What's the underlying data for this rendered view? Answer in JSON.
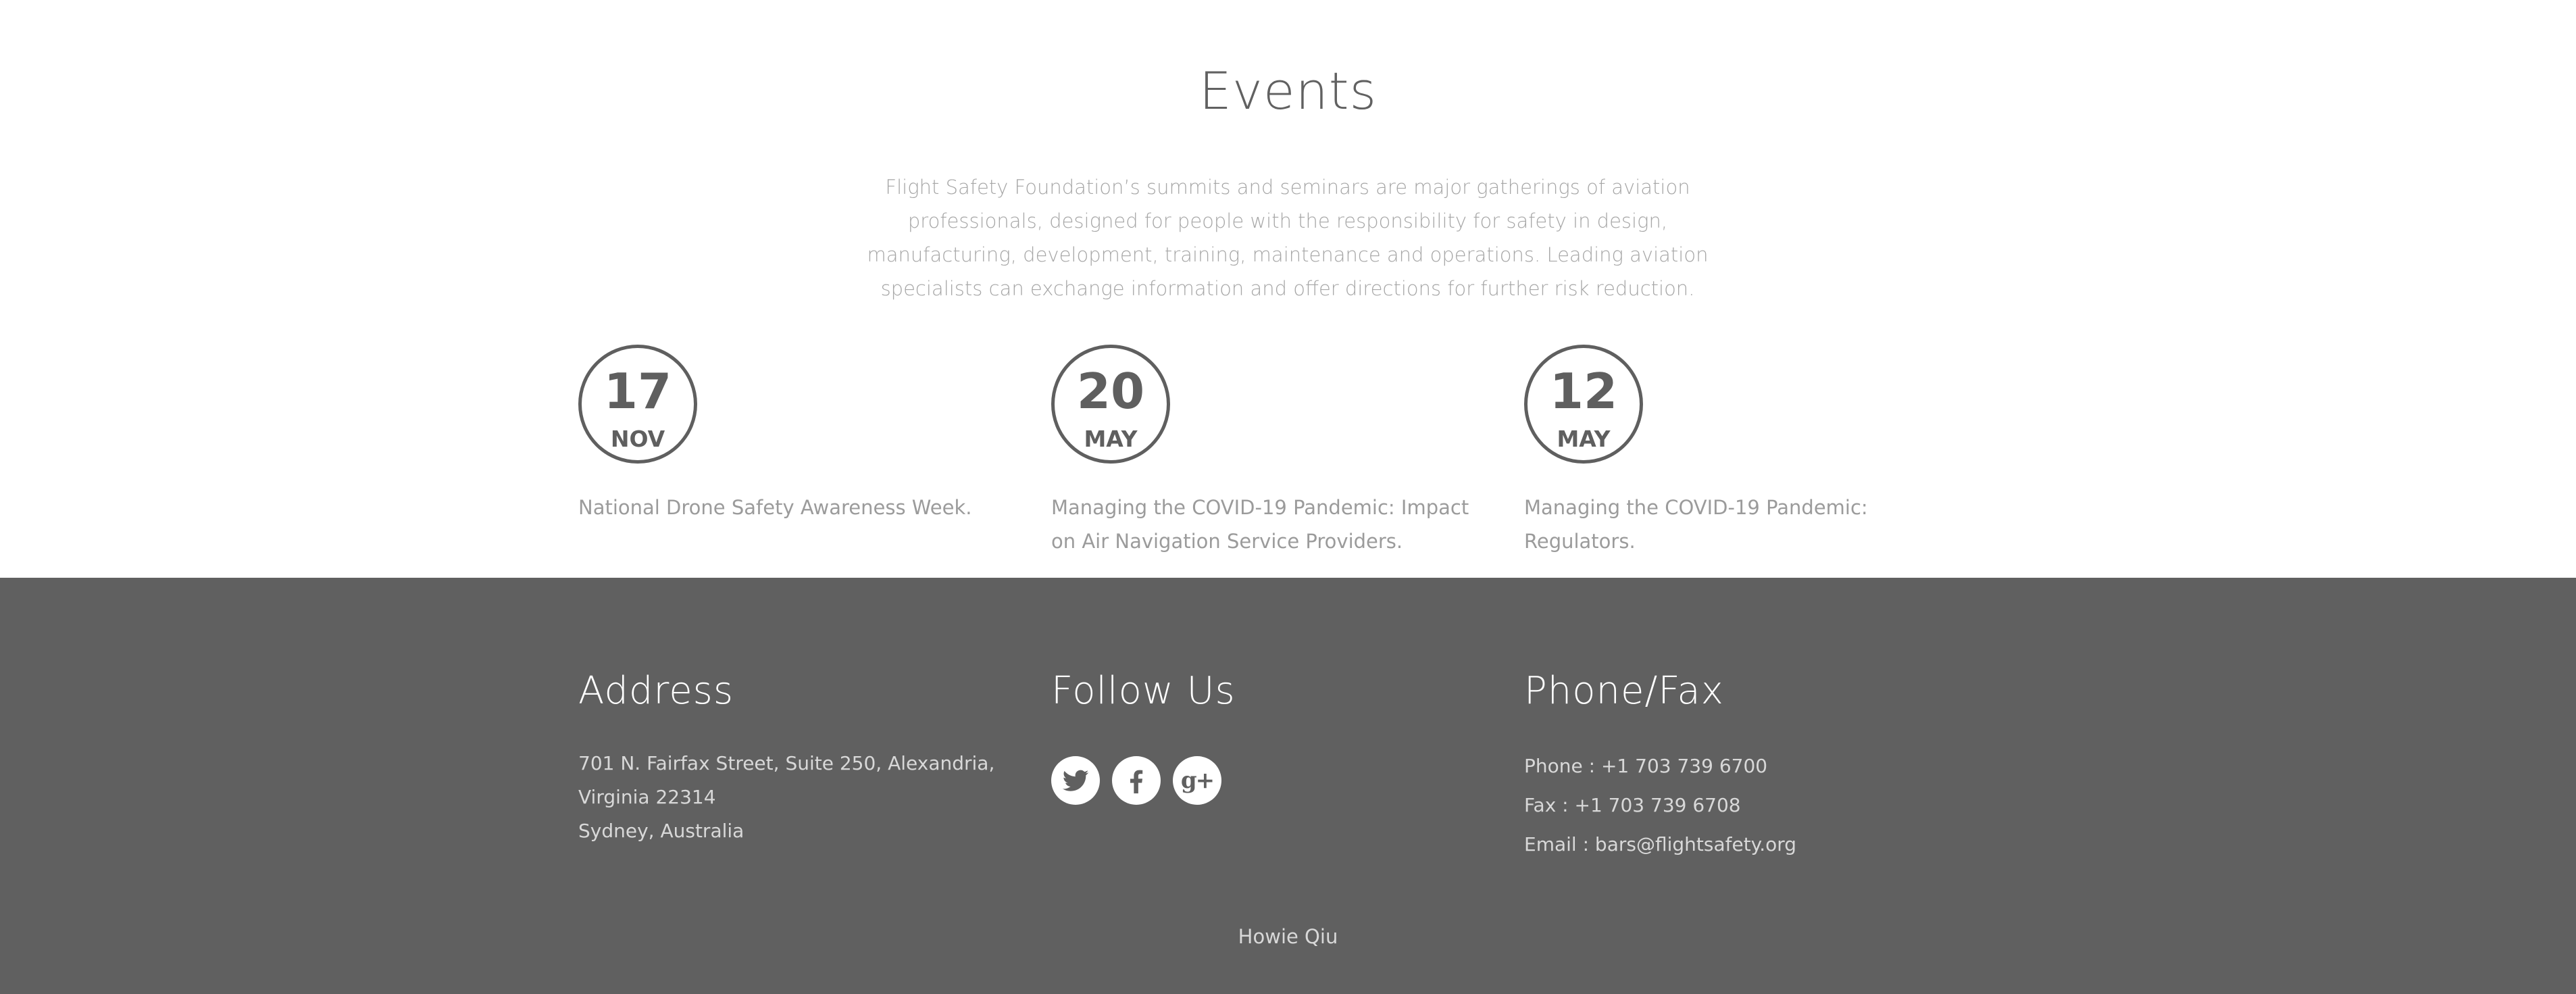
{
  "events": {
    "title": "Events",
    "intro": "Flight Safety Foundation’s summits and seminars are major gatherings of aviation professionals, designed for people with the responsibility for safety in design, manufacturing, development, training, maintenance and operations. Leading aviation specialists can exchange information and offer directions for further risk reduction.",
    "items": [
      {
        "day": "17",
        "month": "NOV",
        "text": "National Drone Safety Awareness Week."
      },
      {
        "day": "20",
        "month": "MAY",
        "text": "Managing the COVID-19 Pandemic: Impact on Air Navigation Service Providers."
      },
      {
        "day": "12",
        "month": "MAY",
        "text": "Managing the COVID-19 Pandemic: Regulators."
      }
    ]
  },
  "footer": {
    "address": {
      "heading": "Address",
      "line1": "701 N. Fairfax Street, Suite 250, Alexandria, Virginia 22314",
      "line2": "Sydney, Australia"
    },
    "follow": {
      "heading": "Follow Us",
      "icons": [
        "twitter-icon",
        "facebook-icon",
        "google-plus-icon"
      ]
    },
    "phone": {
      "heading": "Phone/Fax",
      "phone": "Phone : +1 703 739 6700",
      "fax": "Fax : +1 703 739 6708",
      "email": "Email : bars@flightsafety.org"
    },
    "credit": "Howie Qiu",
    "colors": {
      "background": "#606060",
      "text": "#d8d8d8",
      "heading": "#ffffff"
    }
  }
}
